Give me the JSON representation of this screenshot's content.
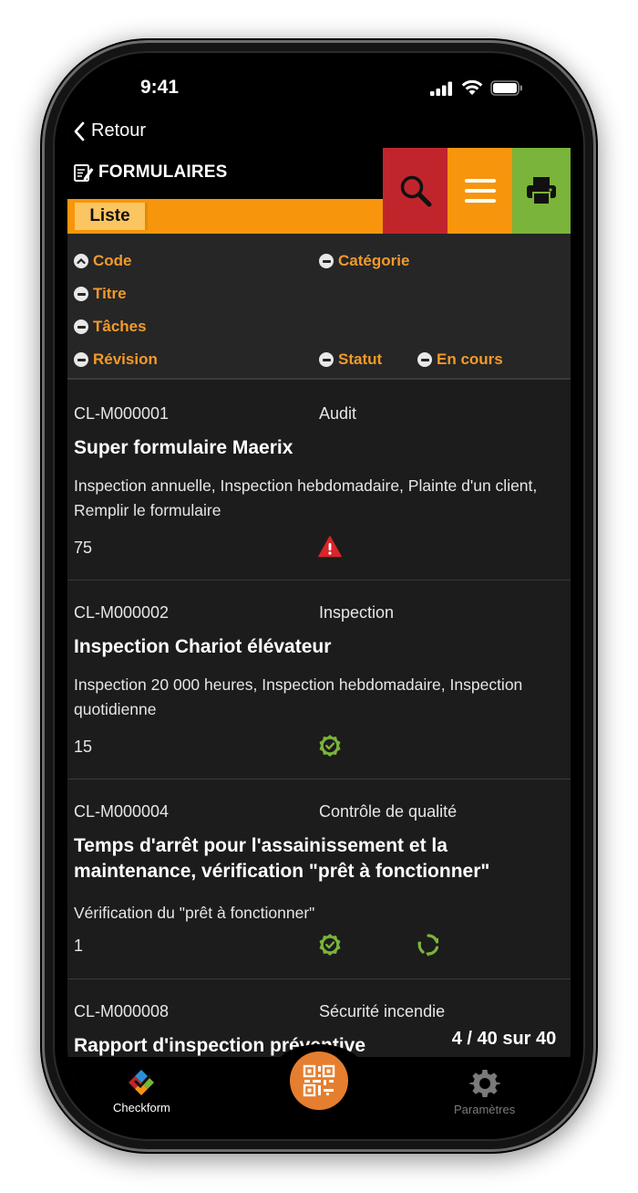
{
  "status_bar": {
    "time": "9:41"
  },
  "nav": {
    "back_label": "Retour"
  },
  "header": {
    "title": "FORMULAIRES",
    "tab_label": "Liste",
    "colors": {
      "search": "#c0252c",
      "menu": "#f7950d",
      "print": "#7ab43a",
      "strip": "#f7950d"
    }
  },
  "sort_headers": {
    "code": "Code",
    "category": "Catégorie",
    "title": "Titre",
    "tasks": "Tâches",
    "revision": "Révision",
    "status": "Statut",
    "in_progress": "En cours"
  },
  "records": [
    {
      "code": "CL-M000001",
      "category": "Audit",
      "title": "Super formulaire Maerix",
      "tasks": "Inspection annuelle, Inspection hebdomadaire, Plainte d'un client, Remplir le formulaire",
      "revision": "75",
      "status_icon": "warning-icon",
      "in_progress_icon": ""
    },
    {
      "code": "CL-M000002",
      "category": "Inspection",
      "title": "Inspection Chariot élévateur",
      "tasks": "Inspection 20 000 heures, Inspection hebdomadaire, Inspection quotidienne",
      "revision": "15",
      "status_icon": "approved-check-icon",
      "in_progress_icon": ""
    },
    {
      "code": "CL-M000004",
      "category": "Contrôle de qualité",
      "title": "Temps d'arrêt pour l'assainissement et la maintenance, vérification \"prêt à fonctionner\"",
      "tasks": "Vérification du \"prêt à fonctionner\"",
      "revision": "1",
      "status_icon": "approved-check-icon",
      "in_progress_icon": "sync-icon"
    },
    {
      "code": "CL-M000008",
      "category": "Sécurité incendie",
      "title": "Rapport d'inspection préventive",
      "tasks": "",
      "revision": "",
      "status_icon": "",
      "in_progress_icon": ""
    }
  ],
  "pager": {
    "text": "4 / 40 sur 40"
  },
  "tab_bar": {
    "checkform_label": "Checkform",
    "settings_label": "Paramètres",
    "fab_icon": "qr-code-icon"
  }
}
